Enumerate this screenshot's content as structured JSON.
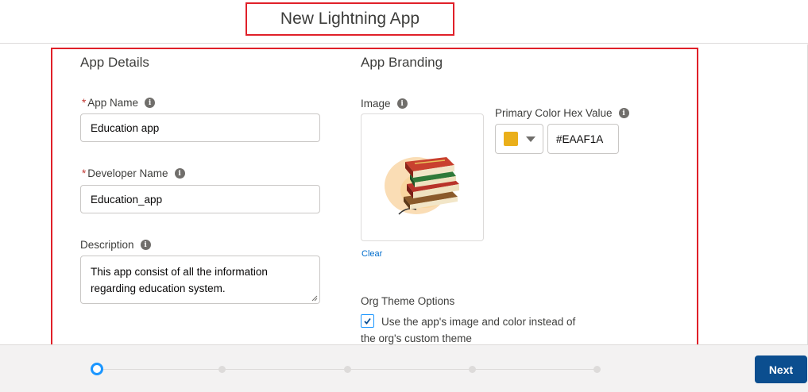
{
  "header": {
    "title": "New Lightning App"
  },
  "details": {
    "section_title": "App Details",
    "app_name": {
      "required_mark": "*",
      "label": "App Name",
      "value": "Education app"
    },
    "developer_name": {
      "required_mark": "*",
      "label": "Developer Name",
      "value": "Education_app"
    },
    "description": {
      "label": "Description",
      "value_line1": "This app consist of all the information",
      "value_line2": "regarding education system."
    },
    "info_glyph": "i"
  },
  "branding": {
    "section_title": "App Branding",
    "image_label": "Image",
    "clear_link": "Clear",
    "color_label": "Primary Color Hex Value",
    "color_value": "#EAAF1A",
    "swatch_color": "#EAAF1A",
    "theme_label": "Org Theme Options",
    "theme_checkbox_checked": true,
    "theme_text_line1": "Use the app's image and color instead of",
    "theme_text_line2": "the org's custom theme"
  },
  "footer": {
    "next_label": "Next",
    "steps": 5,
    "current_step": 1
  },
  "colors": {
    "brand": "#0b4e8f",
    "accent": "#1b96ff",
    "highlight": "#e02029"
  }
}
